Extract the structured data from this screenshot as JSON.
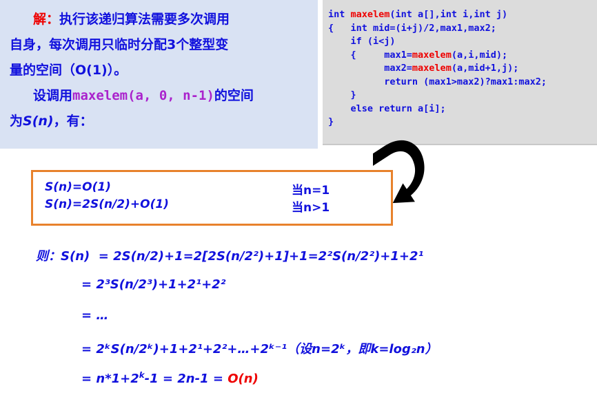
{
  "explanation": {
    "label_solution": "解：",
    "line1_rest": "执行该递归算法需要多次调用",
    "line2": "自身，每次调用只临时分配3个整型变",
    "line3": "量的空间（O(1)）。",
    "line4_pre": "设调用",
    "line4_call": "maxelem(a, 0, n-1)",
    "line4_post": "的空间",
    "line5_pre": "为",
    "line5_sn": "S(n)",
    "line5_post": "，有："
  },
  "code": {
    "lines": [
      "int maxelem(int a[],int i,int j)",
      "{   int mid=(i+j)/2,max1,max2;",
      "    if (i<j)",
      "    {     max1=maxelem(a,i,mid);",
      "          max2=maxelem(a,mid+1,j);",
      "          return (max1>max2)?max1:max2;",
      "    }",
      "    else return a[i];",
      "}"
    ],
    "function_name": "maxelem"
  },
  "recurrence": {
    "rows": [
      {
        "lhs": "S(n)=O(1)",
        "cond": "当n=1"
      },
      {
        "lhs": "S(n)=2S(n/2)+O(1)",
        "cond": "当n>1"
      }
    ]
  },
  "derivation": {
    "lead": "则：S(n)",
    "line1": "=  2S(n/2)+1=2[2S(n/2²)+1]+1=2²S(n/2²)+1+2¹",
    "line2": "=  2³S(n/2³)+1+2¹+2²",
    "line3": "=  …",
    "line4": "=  2ᵏS(n/2ᵏ)+1+2¹+2²+…+2ᵏ⁻¹（设n=2ᵏ，即k=log₂n）",
    "line5": "=  n*1+2ᵏ-1  =  2n-1  =  O(n)",
    "line5_result": "O(n)"
  },
  "colors": {
    "panel_blue": "#d9e2f3",
    "code_gray": "#dcdcdc",
    "text_blue": "#1111dd",
    "accent_red": "#ee0000",
    "accent_magenta": "#aa22cc",
    "box_orange": "#e8822c",
    "arrow_black": "#000000"
  }
}
